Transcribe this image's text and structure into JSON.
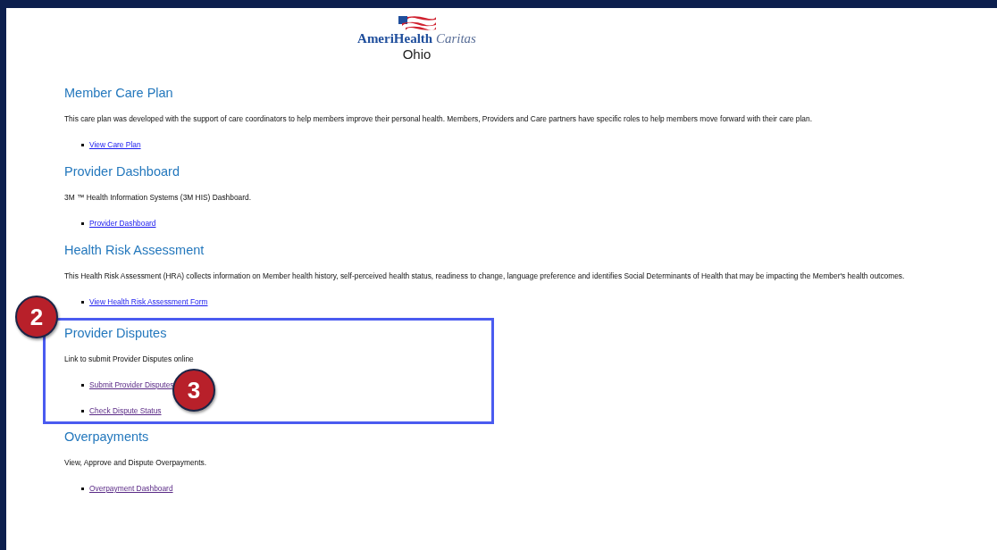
{
  "logo": {
    "brand": "AmeriHealth",
    "brand_script": "Caritas",
    "region": "Ohio"
  },
  "sections": [
    {
      "title": "Member Care Plan",
      "description": "This care plan was developed with the support of care coordinators to help members improve their personal health. Members, Providers and Care partners have specific roles to help members move forward with their care plan.",
      "highlighted": false,
      "links": [
        {
          "label": "View Care Plan",
          "visited": false
        }
      ]
    },
    {
      "title": "Provider Dashboard",
      "description": "3M ™ Health Information Systems (3M HIS) Dashboard.",
      "highlighted": false,
      "links": [
        {
          "label": "Provider Dashboard",
          "visited": false
        }
      ]
    },
    {
      "title": "Health Risk Assessment",
      "description": "This Health Risk Assessment (HRA) collects information on Member health history, self-perceived health status, readiness to change, language preference and identifies Social Determinants of Health that may be impacting the Member's health outcomes.",
      "highlighted": false,
      "links": [
        {
          "label": "View Health Risk Assessment Form",
          "visited": false
        }
      ]
    },
    {
      "title": "Provider Disputes",
      "description": "Link to submit Provider Disputes online",
      "highlighted": true,
      "callout": "2",
      "links": [
        {
          "label": "Submit Provider Disputes",
          "visited": true,
          "callout": "3"
        },
        {
          "label": "Check Dispute Status",
          "visited": true
        }
      ]
    },
    {
      "title": "Overpayments",
      "description": "View, Approve and Dispute Overpayments.",
      "highlighted": false,
      "links": [
        {
          "label": "Overpayment Dashboard",
          "visited": true
        }
      ]
    }
  ]
}
